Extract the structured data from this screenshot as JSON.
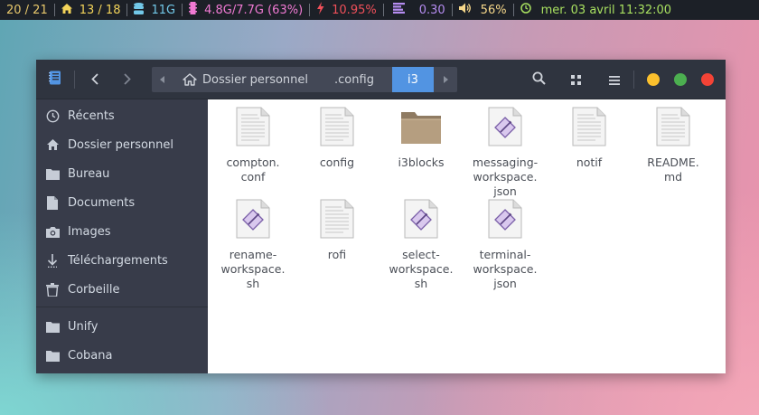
{
  "statusbar": {
    "workspaces": "20 / 21",
    "updates": "13 / 18",
    "disk": "11G",
    "memory": "4.8G/7.7G (63%)",
    "cpu": "10.95%",
    "load": "0.30",
    "volume": "56%",
    "datetime": "mer. 03 avril 11:32:00",
    "colors": {
      "workspaces": "#e8c86c",
      "home": "#f3d45a",
      "disk": "#72c8e8",
      "memory": "#f07ad3",
      "cpu": "#f0505a",
      "load": "#b58cf0",
      "volume": "#f6d78a",
      "clock": "#a8e060"
    }
  },
  "window": {
    "nav_back_icon": "chevron-left-icon",
    "nav_forward_icon": "chevron-right-icon",
    "path": {
      "home": "Dossier personnel",
      "config": ".config",
      "current": "i3"
    },
    "accent": "#5294e2",
    "buttons": {
      "minimize_color": "#fbc02d",
      "maximize_color": "#4caf50",
      "close_color": "#f44336"
    }
  },
  "sidebar": {
    "items": [
      {
        "label": "Récents",
        "icon": "clock-icon"
      },
      {
        "label": "Dossier personnel",
        "icon": "home-icon"
      },
      {
        "label": "Bureau",
        "icon": "folder-icon"
      },
      {
        "label": "Documents",
        "icon": "document-icon"
      },
      {
        "label": "Images",
        "icon": "camera-icon"
      },
      {
        "label": "Téléchargements",
        "icon": "download-icon"
      },
      {
        "label": "Corbeille",
        "icon": "trash-icon"
      },
      {
        "label": "Unify",
        "icon": "folder-icon"
      },
      {
        "label": "Cobana",
        "icon": "folder-icon"
      }
    ]
  },
  "files": [
    {
      "name": "compton.\nconf",
      "type": "text"
    },
    {
      "name": "config",
      "type": "text"
    },
    {
      "name": "i3blocks",
      "type": "folder"
    },
    {
      "name": "messaging-\nworkspace.\njson",
      "type": "script"
    },
    {
      "name": "notif",
      "type": "text"
    },
    {
      "name": "README.\nmd",
      "type": "text"
    },
    {
      "name": "rename-\nworkspace.\nsh",
      "type": "script"
    },
    {
      "name": "rofi",
      "type": "text"
    },
    {
      "name": "select-\nworkspace.\nsh",
      "type": "script"
    },
    {
      "name": "terminal-\nworkspace.\njson",
      "type": "script"
    }
  ]
}
